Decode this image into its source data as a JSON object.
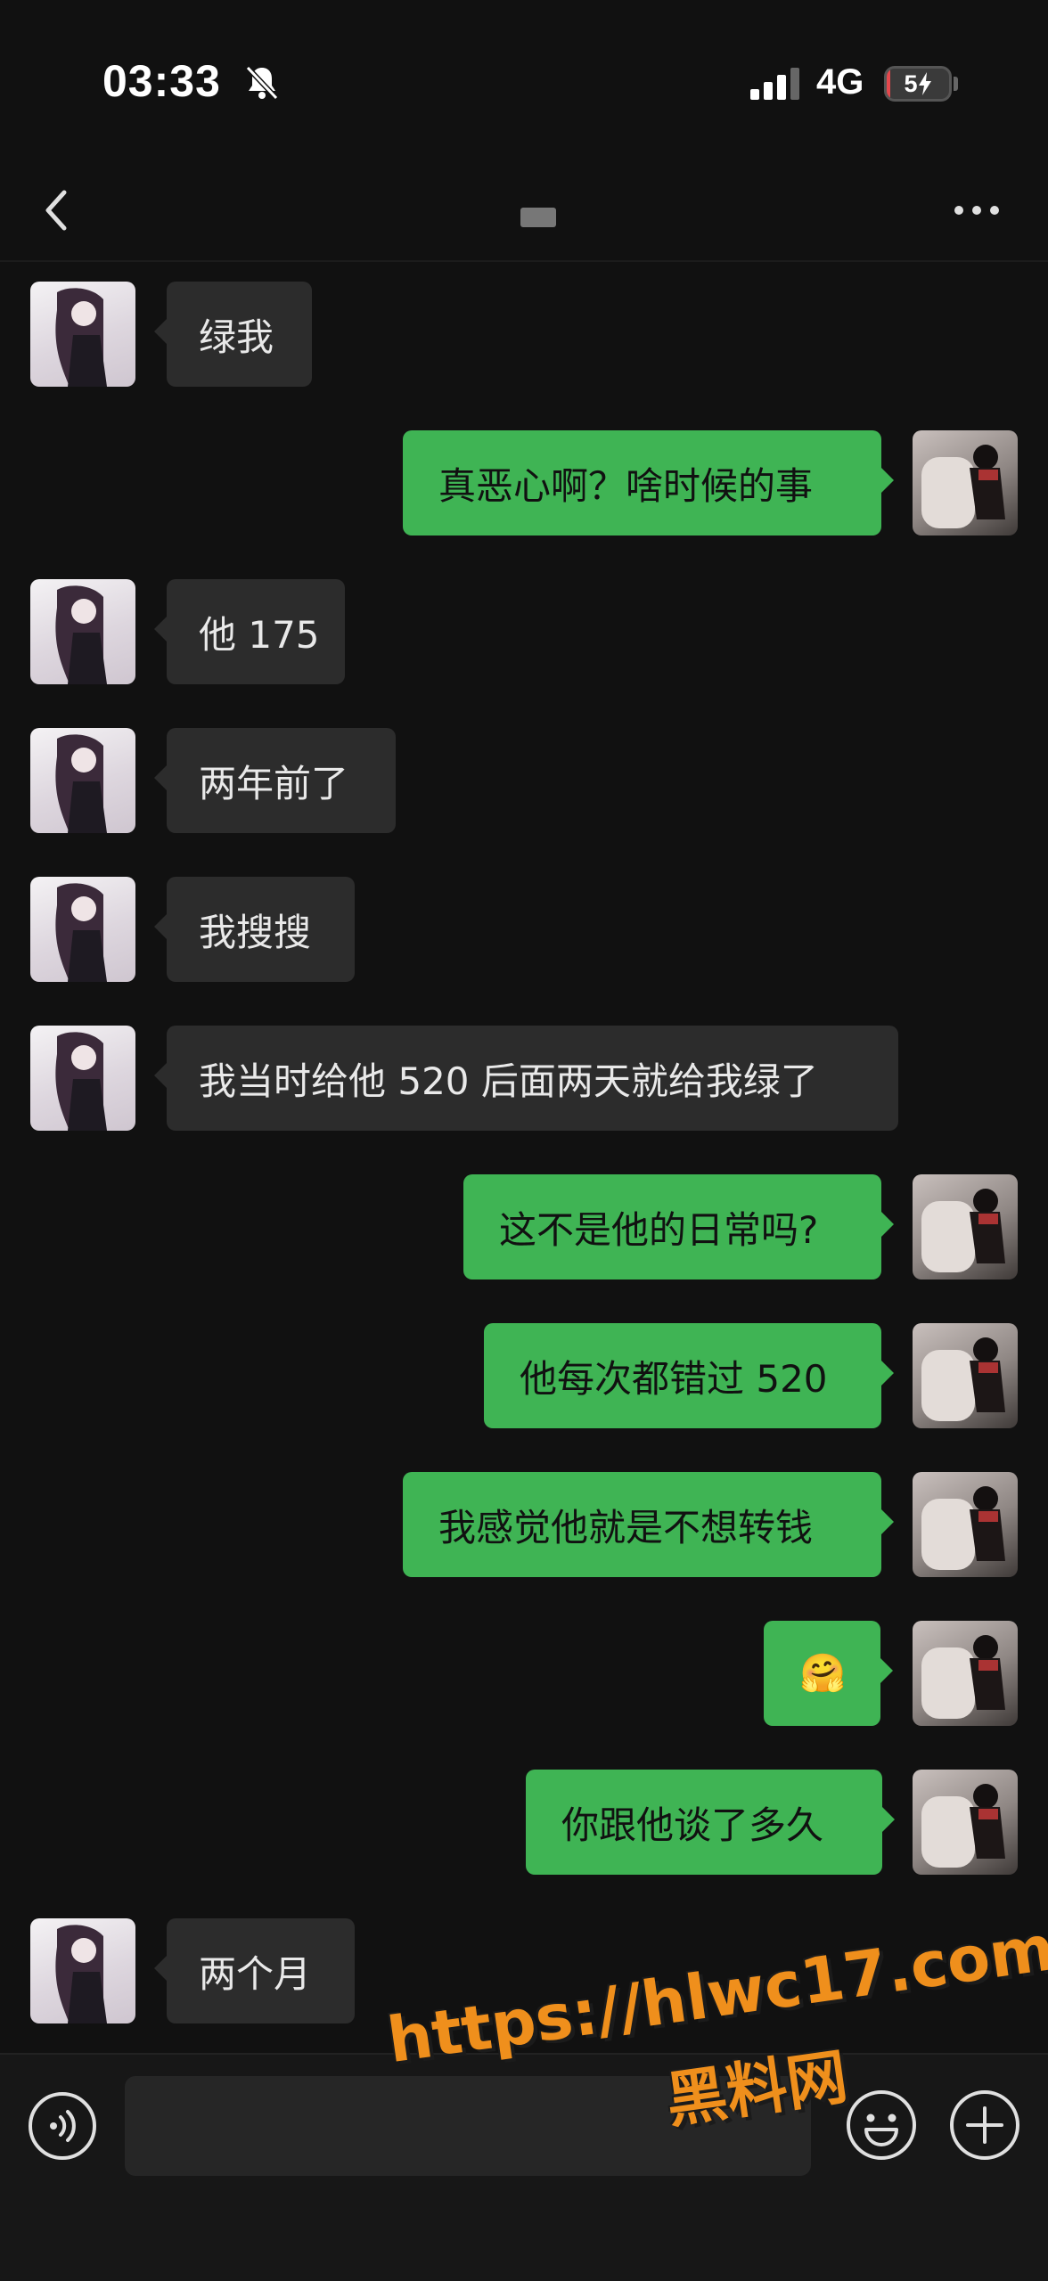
{
  "status_bar": {
    "time": "03:33",
    "network": "4G",
    "battery_level": "5",
    "battery_fraction": 0.05,
    "icons": [
      "bell-slash-icon",
      "signal-icon",
      "charging-bolt-icon"
    ]
  },
  "nav": {
    "icons": [
      "chevron-left-icon",
      "more-icon"
    ]
  },
  "messages": [
    {
      "side": "left",
      "text": "绿我"
    },
    {
      "side": "right",
      "text": "真恶心啊？啥时候的事"
    },
    {
      "side": "left",
      "text": "他 175"
    },
    {
      "side": "left",
      "text": "两年前了"
    },
    {
      "side": "left",
      "text": "我搜搜"
    },
    {
      "side": "left",
      "text": "我当时给他 520 后面两天就给我绿了"
    },
    {
      "side": "right",
      "text": "这不是他的日常吗?"
    },
    {
      "side": "right",
      "text": "他每次都错过 520"
    },
    {
      "side": "right",
      "text": "我感觉他就是不想转钱"
    },
    {
      "side": "right",
      "text": "🤗"
    },
    {
      "side": "right",
      "text": "你跟他谈了多久"
    },
    {
      "side": "left",
      "text": "两个月"
    }
  ],
  "input_bar": {
    "value": "",
    "icons": [
      "voice-icon",
      "smile-icon",
      "plus-icon"
    ]
  },
  "watermark": {
    "url": "https://hlwc17.com",
    "name": "黑料网"
  },
  "colors": {
    "background": "#111111",
    "incoming_bubble": "#2c2c2c",
    "outgoing_bubble": "#3fb454",
    "watermark": "#ef8f1c",
    "battery_low": "#e5484d"
  }
}
